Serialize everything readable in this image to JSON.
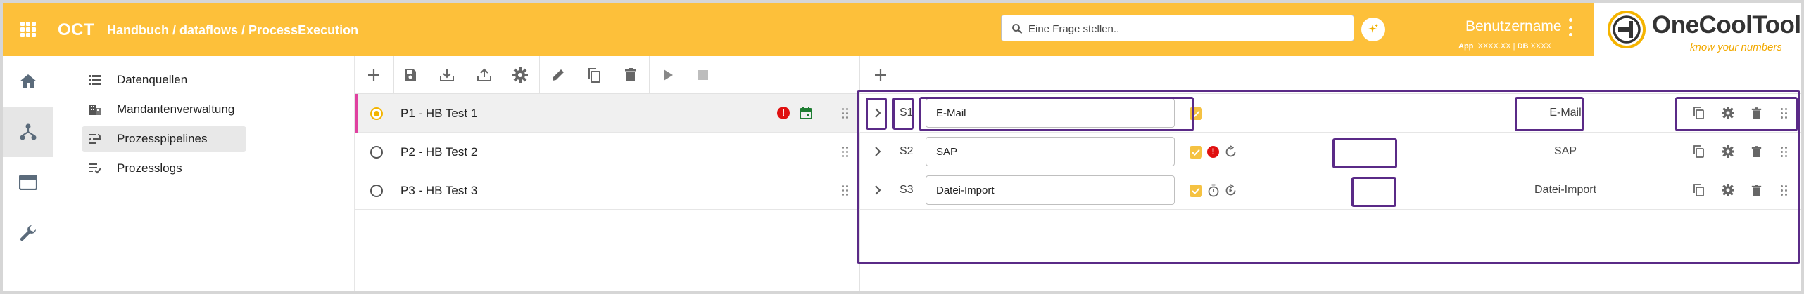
{
  "header": {
    "app_title": "OCT",
    "breadcrumb": "Handbuch / dataflows / ProcessExecution",
    "search_placeholder": "Eine Frage stellen..",
    "user_name": "Benutzername",
    "app_label": "App",
    "app_value": "XXXX.XX",
    "db_label": "DB",
    "db_value": "XXXX",
    "separator": "|",
    "logo_text": "OneCoolTool",
    "logo_tagline": "know your numbers"
  },
  "colors": {
    "header_bg": "#fdc03a",
    "accent_pink": "#e040a0",
    "highlight_purple": "#5a2a87",
    "error_red": "#e01010",
    "check_yellow": "#f5c242"
  },
  "rail": [
    {
      "icon": "home-icon"
    },
    {
      "icon": "flow-network-icon",
      "active": true
    },
    {
      "icon": "window-icon"
    },
    {
      "icon": "wrench-icon"
    }
  ],
  "nav": {
    "items": [
      {
        "label": "Datenquellen",
        "icon": "list-icon"
      },
      {
        "label": "Mandantenverwaltung",
        "icon": "building-icon"
      },
      {
        "label": "Prozesspipelines",
        "icon": "pipeline-icon",
        "active": true
      },
      {
        "label": "Prozesslogs",
        "icon": "log-check-icon"
      }
    ]
  },
  "pipelines": [
    {
      "label": "P1 - HB Test 1",
      "selected": true,
      "has_error": true,
      "has_schedule": true
    },
    {
      "label": "P2 - HB Test 2",
      "selected": false
    },
    {
      "label": "P3 - HB Test 3",
      "selected": false
    }
  ],
  "steps": [
    {
      "id": "S1",
      "name": "E-Mail",
      "type": "E-Mail",
      "checked": true
    },
    {
      "id": "S2",
      "name": "SAP",
      "type": "SAP",
      "checked": true,
      "status": [
        "error-icon",
        "refresh-icon"
      ]
    },
    {
      "id": "S3",
      "name": "Datei-Import",
      "type": "Datei-Import",
      "checked": true,
      "status": [
        "timer-icon",
        "retry-icon"
      ]
    }
  ]
}
